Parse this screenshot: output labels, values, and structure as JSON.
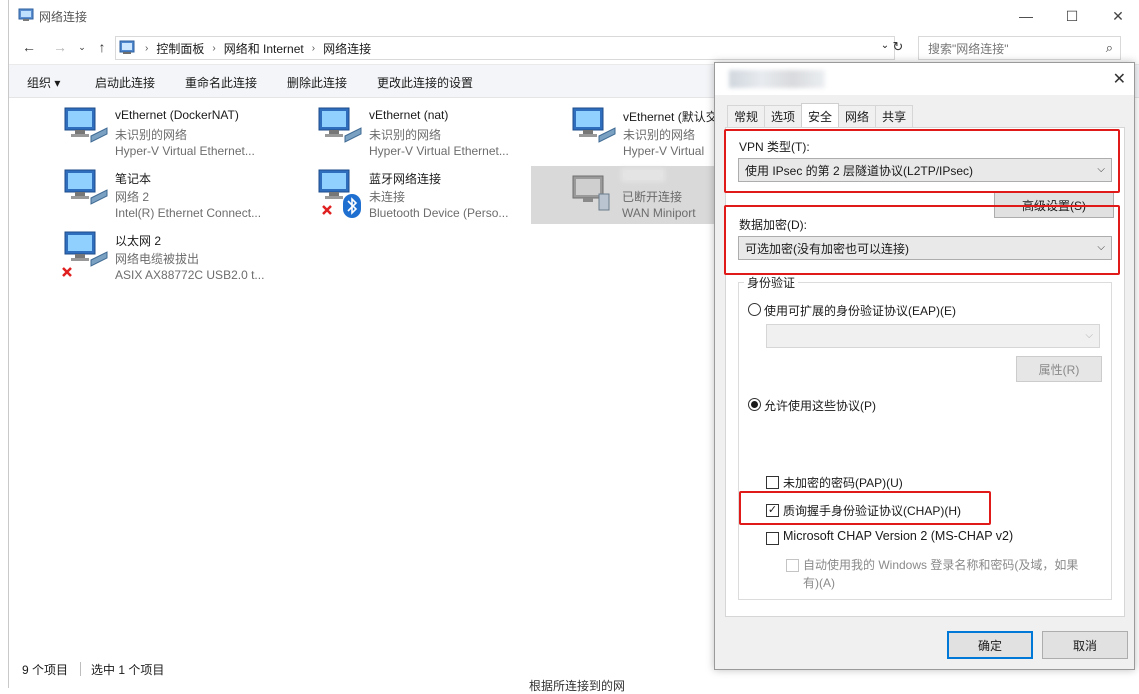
{
  "window": {
    "title": "网络连接"
  },
  "address": {
    "crumbs": [
      "控制面板",
      "网络和 Internet",
      "网络连接"
    ],
    "search_placeholder": "搜索\"网络连接\""
  },
  "commands": [
    "组织 ▾",
    "启动此连接",
    "重命名此连接",
    "删除此连接",
    "更改此连接的设置"
  ],
  "connections": [
    {
      "name": "vEthernet (DockerNAT)",
      "status": "未识别的网络",
      "device": "Hyper-V Virtual Ethernet..."
    },
    {
      "name": "vEthernet (nat)",
      "status": "未识别的网络",
      "device": "Hyper-V Virtual Ethernet..."
    },
    {
      "name": "vEthernet (默认交",
      "status": "未识别的网络",
      "device": "Hyper-V Virtual"
    },
    {
      "name": "笔记本",
      "status": "网络 2",
      "device": "Intel(R) Ethernet Connect..."
    },
    {
      "name": "蓝牙网络连接",
      "status": "未连接",
      "device": "Bluetooth Device (Perso..."
    },
    {
      "name": "",
      "status": "已断开连接",
      "device": "WAN Miniport"
    },
    {
      "name": "以太网 2",
      "status": "网络电缆被拔出",
      "device": "ASIX AX88772C USB2.0 t..."
    }
  ],
  "statusbar": {
    "count": "9 个项目",
    "selected": "选中 1 个项目"
  },
  "bottom_text": "根据所连接到的网",
  "dialog": {
    "tabs": [
      "常规",
      "选项",
      "安全",
      "网络",
      "共享"
    ],
    "active_tab": "安全",
    "vpn_type_label": "VPN 类型(T):",
    "vpn_type_value": "使用 IPsec 的第 2 层隧道协议(L2TP/IPsec)",
    "advanced_button": "高级设置(S)",
    "encryption_label": "数据加密(D):",
    "encryption_value": "可选加密(没有加密也可以连接)",
    "auth_group": "身份验证",
    "eap_radio": "使用可扩展的身份验证协议(EAP)(E)",
    "eap_selected": false,
    "properties_button": "属性(R)",
    "allow_radio": "允许使用这些协议(P)",
    "allow_selected": true,
    "pap": {
      "label": "未加密的密码(PAP)(U)",
      "checked": false
    },
    "chap": {
      "label": "质询握手身份验证协议(CHAP)(H)",
      "checked": true
    },
    "mschap": {
      "label": "Microsoft CHAP Version 2 (MS-CHAP v2)",
      "checked": false
    },
    "autologon": {
      "line1": "自动使用我的 Windows 登录名称和密码(及域，如果",
      "line2": "有)(A)",
      "checked": false
    },
    "ok": "确定",
    "cancel": "取消"
  },
  "colors": {
    "highlight_box": "#e01919",
    "primary_border": "#0078d7",
    "command_bar": "#f3f5f8"
  }
}
